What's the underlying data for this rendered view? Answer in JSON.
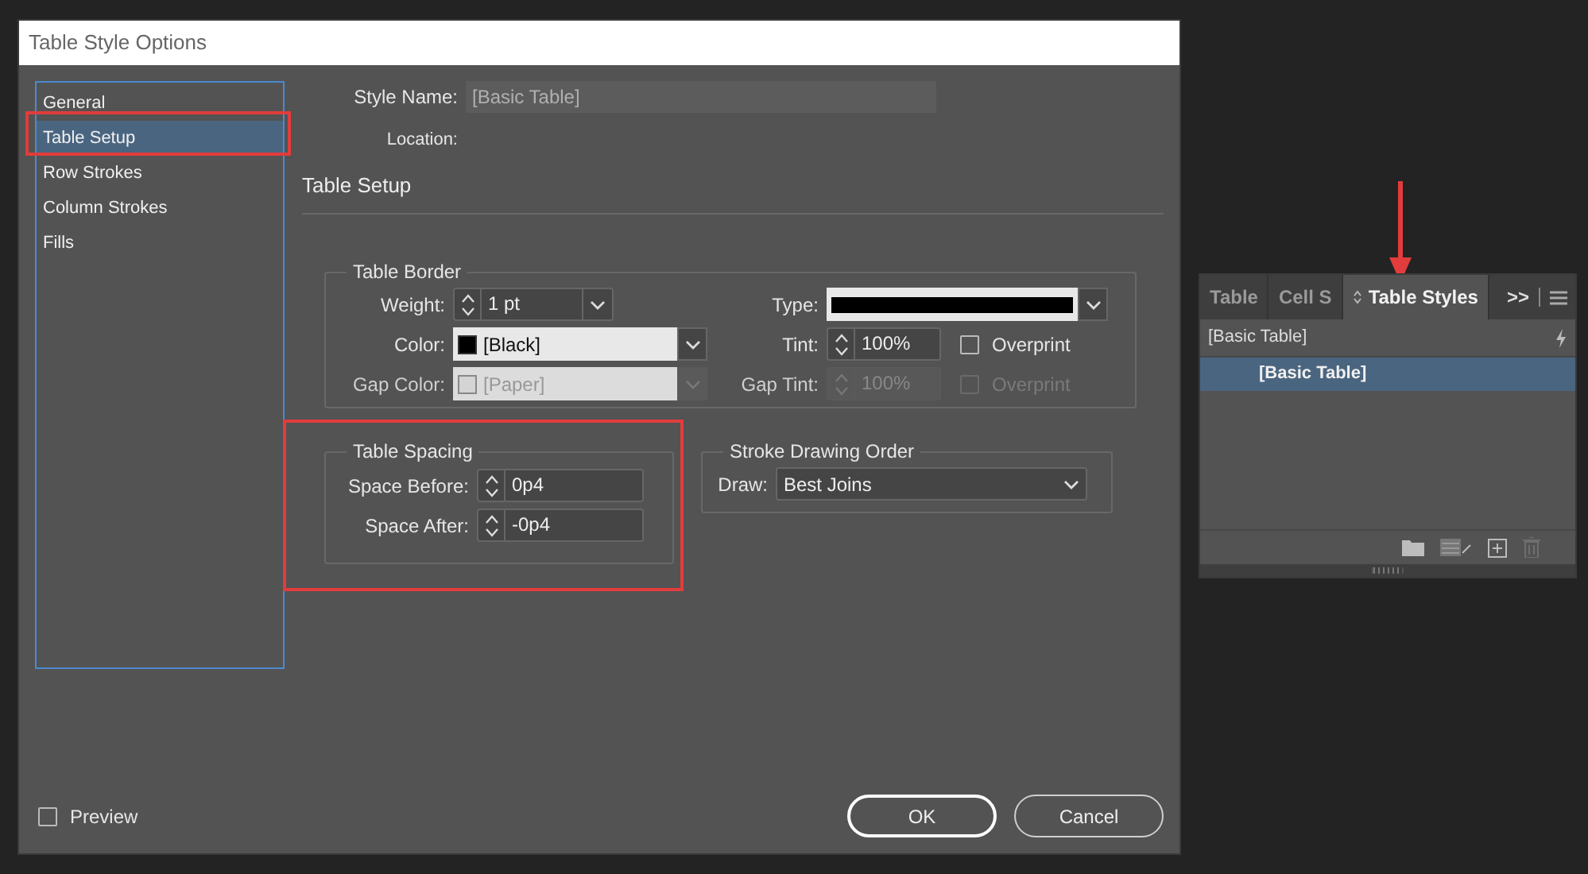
{
  "dialog": {
    "title": "Table Style Options",
    "sidebar": [
      {
        "label": "General",
        "selected": false
      },
      {
        "label": "Table Setup",
        "selected": true
      },
      {
        "label": "Row Strokes",
        "selected": false
      },
      {
        "label": "Column Strokes",
        "selected": false
      },
      {
        "label": "Fills",
        "selected": false
      }
    ],
    "style_name": {
      "label": "Style Name:",
      "value": "[Basic Table]"
    },
    "location": {
      "label": "Location:"
    },
    "section_title": "Table Setup",
    "table_border": {
      "title": "Table Border",
      "weight": {
        "label": "Weight:",
        "value": "1 pt"
      },
      "type": {
        "label": "Type:"
      },
      "color": {
        "label": "Color:",
        "value": "[Black]",
        "color": "#000000",
        "disabled": false
      },
      "tint": {
        "label": "Tint:",
        "value": "100%",
        "disabled": false
      },
      "overprint": {
        "label": "Overprint",
        "checked": false,
        "disabled": false
      },
      "gap_color": {
        "label": "Gap Color:",
        "value": "[Paper]",
        "color": "#d4d4d4",
        "disabled": true
      },
      "gap_tint": {
        "label": "Gap Tint:",
        "value": "100%",
        "disabled": true
      },
      "gap_overprint": {
        "label": "Overprint",
        "checked": false,
        "disabled": true
      }
    },
    "table_spacing": {
      "title": "Table Spacing",
      "space_before": {
        "label": "Space Before:",
        "value": "0p4"
      },
      "space_after": {
        "label": "Space After:",
        "value": "-0p4"
      }
    },
    "stroke_drawing_order": {
      "title": "Stroke Drawing Order",
      "draw": {
        "label": "Draw:",
        "value": "Best Joins"
      }
    },
    "preview": {
      "label": "Preview",
      "checked": false
    },
    "buttons": [
      {
        "label": "OK",
        "kind": "primary"
      },
      {
        "label": "Cancel",
        "kind": "secondary"
      }
    ]
  },
  "panel": {
    "tabs": [
      {
        "label": "Table",
        "selected": false
      },
      {
        "label": "Cell S",
        "selected": false
      },
      {
        "label": "Table Styles",
        "selected": true
      }
    ],
    "overflow": ">>",
    "group": "[Basic Table]",
    "styles": [
      {
        "label": "[Basic Table]",
        "selected": true
      }
    ],
    "toolbar": [
      {
        "kind": "folder",
        "disabled": false
      },
      {
        "kind": "clear-overrides",
        "disabled": false
      },
      {
        "kind": "new",
        "disabled": false
      },
      {
        "kind": "delete",
        "disabled": true
      }
    ]
  }
}
